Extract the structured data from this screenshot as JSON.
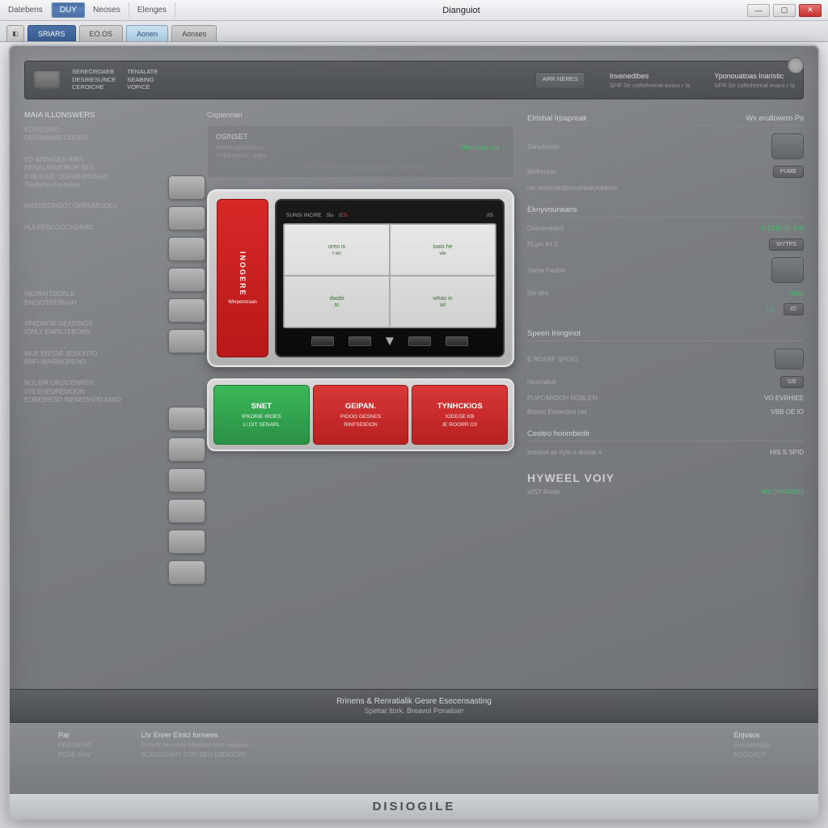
{
  "titlebar": {
    "items": [
      "Datebens",
      "DUY",
      "Neoses",
      "Elenges"
    ],
    "center": "Dianguiot"
  },
  "tabs": {
    "primary": "SRIARS",
    "items": [
      "EO.OS",
      "Aonen",
      "Aonses"
    ]
  },
  "header": {
    "block1": [
      "SERECROAEB",
      "DESIRESUNCE",
      "CEROICHE"
    ],
    "block2": [
      "TENALATE",
      "SEABING",
      "VOPICE"
    ],
    "pill": "ARR NERES",
    "col1": {
      "title": "Invenedibes",
      "sub": "SFR Se cotlishrenal evaro r la"
    },
    "col2": {
      "title": "Yponouatoas Inaristic",
      "sub": "SFR Se cotlishrenal evaro r la"
    }
  },
  "left": {
    "head1": "MAIA ILLONSWERS",
    "g1": [
      "KOVILORIE",
      "DEEOHOMS LEIOFLI"
    ],
    "g2": [
      "VD IMIDAGEN KIBS",
      "RENALANMOBOR RES",
      "© IB IEIRE OORDERIDINGS",
      "Theilonss Fremoen"
    ],
    "g3": [
      "WAEREORGOT ORRUMEIOES"
    ],
    "g4": [
      "HULPERCOOCHORAD"
    ],
    "g5": [
      "INGIRAITOORLE",
      "BNOIOTRERNAH"
    ],
    "g6": [
      "VPADROM GEARINOS",
      "IONLY ENRILTEBONS"
    ],
    "g7": [
      "MIJE ENTOR JEBIOUTO",
      "BNFI WAIRNOHENO"
    ],
    "g8": [
      "NOLEIR ORUIDENREH",
      "GIS EHEOREMOON",
      "EOREBIESO SIENEOHOD MIRD"
    ]
  },
  "center": {
    "info": {
      "banner": "Copiennan",
      "title": "OSINSET",
      "lines": [
        "SMOCBEBNOSS",
        "TVEERDOT I MER"
      ],
      "link": "Vifeensec eap i",
      "bottom": "NOPY ENIEPH OUNISENDADENDID TEH PARE"
    },
    "device": {
      "side_label": "INOGERE",
      "side_sub": "Winperocoan",
      "top": [
        "SUNSI INCIRE",
        "Sis",
        "IES",
        "IIS"
      ],
      "cells": [
        {
          "a": "oreo is",
          "b": "t en"
        },
        {
          "a": "ioais he",
          "b": "vie"
        },
        {
          "a": "dwobi",
          "b": "bt"
        },
        {
          "a": "whao in",
          "b": "lef"
        }
      ]
    },
    "actions": [
      {
        "t": "SNET",
        "s1": "IPKORIE IROES",
        "s2": "LI OIT SENARL"
      },
      {
        "t": "GEIPAN.",
        "s1": "PIOOO GESNES",
        "s2": "RINFSEIEION"
      },
      {
        "t": "TYNHCKIOS",
        "s1": "IODEGE KB",
        "s2": "IE ROORR OII"
      }
    ]
  },
  "right": {
    "sec1": {
      "title": "Elrishal Irpapreak",
      "right": "Ws erullowrro Ps",
      "sub": "Sanylonion"
    },
    "rows1": [
      {
        "lbl": "Mirfrerson",
        "val": "PUME"
      },
      {
        "lbl": "ror semicrantbronsheoryeperse",
        "val": ""
      }
    ],
    "sec2": {
      "title": "Eknyvourwans"
    },
    "rows2": [
      {
        "lbl": "Ossoeveend",
        "val": "PISTIFOR 900"
      },
      {
        "lbl": "PLym IH S",
        "val": "WYTPS"
      },
      {
        "lbl": "Yarna Fanble",
        "val": ""
      },
      {
        "lbl": "the elre",
        "val": "noigs",
        "green": true
      },
      {
        "lbl": "",
        "val": "LG",
        "green": true
      }
    ],
    "sec3": {
      "title": "Speen Ininginot"
    },
    "rows3": [
      {
        "lbl": "E ROARF SPOID",
        "val": ""
      },
      {
        "lbl": "Hesiriakat",
        "val": "SIE"
      },
      {
        "lbl": "PUPCARDOH NOBLEN",
        "val": "VO EVRHIEE"
      },
      {
        "lbl": "Brsmo Esinechm het",
        "val": "VBB OE IO"
      }
    ],
    "sec4": {
      "title": "Cesteo hoombedir"
    },
    "rows4": [
      {
        "lbl": "Inrrasol as nyte s drosar s",
        "val": "HIS S SPID"
      }
    ],
    "brand": "HYWEEL VOIY",
    "rows5": [
      {
        "lbl": "WST Ronis",
        "val": "WKOIPRROID",
        "green": true
      }
    ]
  },
  "footer": {
    "strip1": "Rrinens & Renratialik Gesre Esecensasting",
    "strip2": "Spetiat ltork. Breavol Ponaliser",
    "cols": [
      {
        "h": "Par",
        "lines": [
          "PISEMEME",
          "POSE ANV"
        ]
      },
      {
        "h": "Lhr Enrer Einicl forisees",
        "lines": [
          "Eoreck rercoms Irleshral crinr obease",
          "ROROLDANY FOR SEH EBINDORI"
        ]
      },
      {
        "h": "Enjvaos",
        "lines": [
          "Insnueshaily",
          "RSGOALIY"
        ]
      }
    ],
    "brand": "DISIOGILE"
  }
}
